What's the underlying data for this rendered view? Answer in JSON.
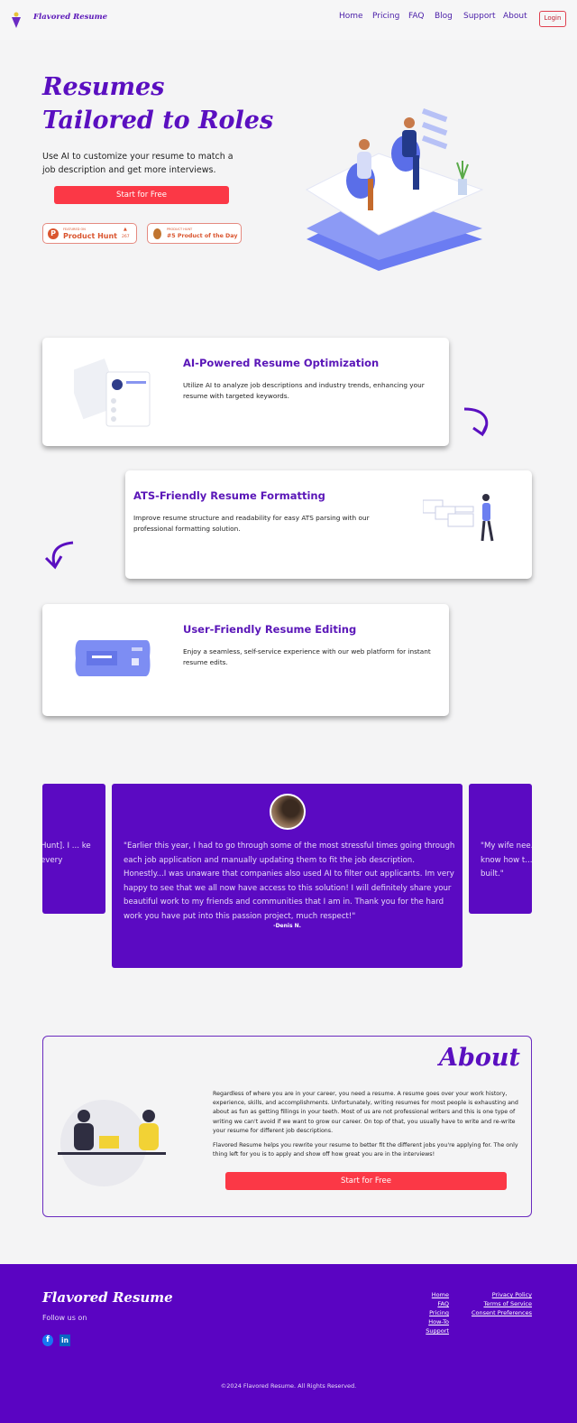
{
  "header": {
    "brand": "Flavored Resume",
    "nav": [
      "Home",
      "Pricing",
      "FAQ",
      "Blog",
      "Support",
      "About"
    ],
    "login": "Login"
  },
  "hero": {
    "title_line1": "Resumes",
    "title_line2": "Tailored to Roles",
    "subtitle": "Use AI to customize your resume to match a job description and get more interviews.",
    "cta": "Start for Free",
    "badge1": {
      "kicker": "FEATURED ON",
      "name": "Product Hunt",
      "votes": "267"
    },
    "badge2": {
      "kicker": "PRODUCT HUNT",
      "name": "#5 Product of the Day"
    }
  },
  "features": [
    {
      "title": "AI-Powered Resume Optimization",
      "text": "Utilize AI to analyze job descriptions and industry trends, enhancing your resume with targeted keywords."
    },
    {
      "title": "ATS-Friendly Resume Formatting",
      "text": "Improve resume structure and readability for easy ATS parsing with our professional formatting solution."
    },
    {
      "title": "User-Friendly Resume Editing",
      "text": "Enjoy a seamless, self-service experience with our web platform for instant resume edits."
    }
  ],
  "testimonials": {
    "left_partial": "Hunt]. I ... ke every",
    "center": {
      "quote": "\"Earlier this year, I had to go through some of the most stressful times going through each job application and manually updating them to fit the job description. Honestly...I was unaware that companies also used AI to filter out applicants. Im very happy to see that we all now have access to this solution! I will definitely share your beautiful work to my friends and communities that I am in. Thank you for the hard work you have put into this passion project, much respect!\"",
      "author": "-Denis N."
    },
    "right_partial": "\"My wife nee... know how t... built.\""
  },
  "about": {
    "title": "About",
    "p1": "Regardless of where you are in your career, you need a resume. A resume goes over your work history, experience, skills, and accomplishments. Unfortunately, writing resumes for most people is exhausting and about as fun as getting fillings in your teeth. Most of us are not professional writers and this is one type of writing we can't avoid if we want to grow our career. On top of that, you usually have to write and re-write your resume for different job descriptions.",
    "p2": "Flavored Resume helps you rewrite your resume to better fit the different jobs you're applying for. The only thing left for you is to apply and show off how great you are in the interviews!",
    "cta": "Start for Free"
  },
  "footer": {
    "brand": "Flavored Resume",
    "follow": "Follow us on",
    "links1": [
      "Home",
      "FAQ",
      "Pricing",
      "How-To",
      "Support"
    ],
    "links2": [
      "Privacy Policy",
      "Terms of Service",
      "Consent Preferences"
    ],
    "copyright": "©2024 Flavored Resume. All Rights Reserved."
  },
  "colors": {
    "primary": "#5a04c2",
    "accent": "#fb3846"
  }
}
